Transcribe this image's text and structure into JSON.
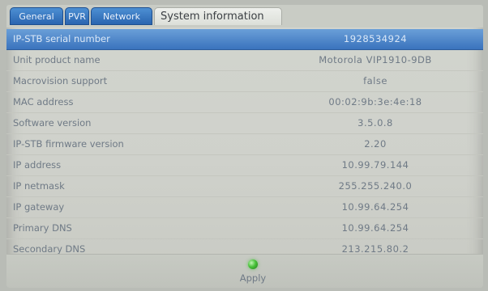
{
  "tabs": [
    {
      "label": "General"
    },
    {
      "label": "PVR"
    },
    {
      "label": "Network"
    },
    {
      "label": "System information",
      "active": true
    }
  ],
  "rows": [
    {
      "label": "IP-STB serial number",
      "value": "1928534924",
      "selected": true
    },
    {
      "label": "Unit product name",
      "value": "Motorola VIP1910-9DB"
    },
    {
      "label": "Macrovision support",
      "value": "false"
    },
    {
      "label": "MAC address",
      "value": "00:02:9b:3e:4e:18"
    },
    {
      "label": "Software version",
      "value": "3.5.0.8"
    },
    {
      "label": "IP-STB firmware version",
      "value": "2.20"
    },
    {
      "label": "IP address",
      "value": "10.99.79.144"
    },
    {
      "label": "IP netmask",
      "value": "255.255.240.0"
    },
    {
      "label": "IP gateway",
      "value": "10.99.64.254"
    },
    {
      "label": "Primary DNS",
      "value": "10.99.64.254"
    },
    {
      "label": "Secondary DNS",
      "value": "213.215.80.2"
    }
  ],
  "footer": {
    "apply_label": "Apply",
    "apply_icon": "green-led-icon",
    "apply_color": "#49c23a"
  },
  "colors": {
    "tab_blue": "#2a65b0",
    "selected_row": "#3a73bd",
    "text": "#6f7a86"
  }
}
